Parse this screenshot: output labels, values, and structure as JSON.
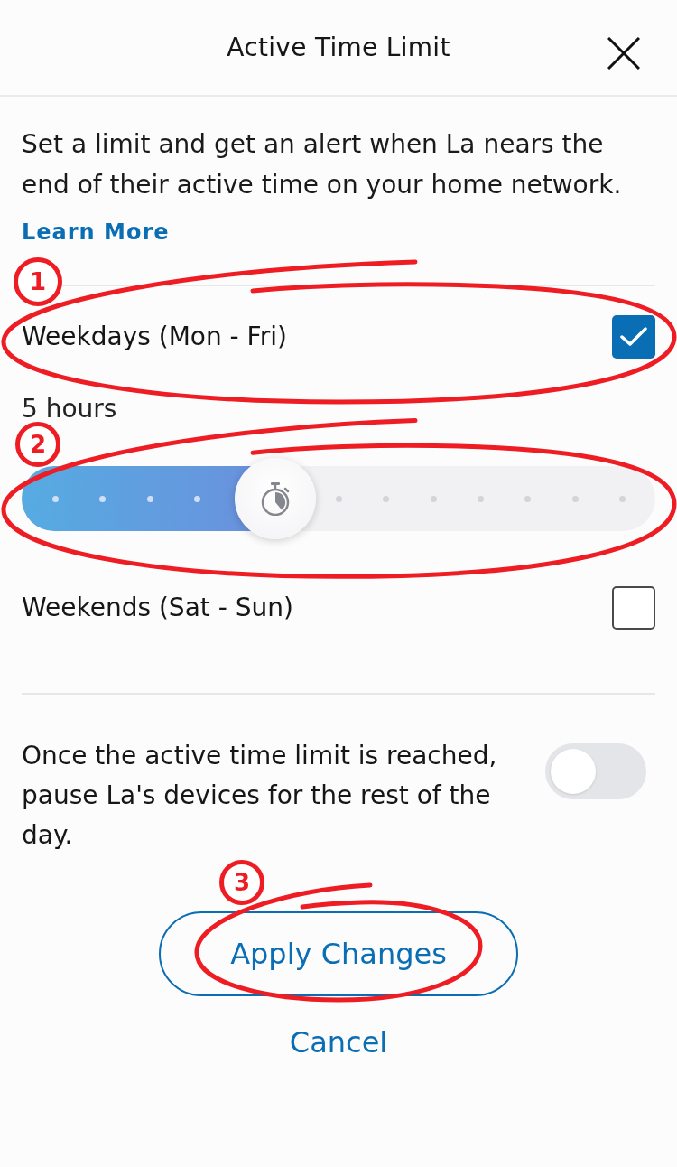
{
  "header": {
    "title": "Active Time Limit"
  },
  "intro": {
    "description": "Set a limit and get an alert when La nears the end of their active time on your home network.",
    "link": "Learn More"
  },
  "schedules": [
    {
      "label": "Weekdays (Mon - Fri)",
      "checked": true,
      "annotation": "1",
      "duration": {
        "reading": "5 hours",
        "level": 0.4,
        "annotation": "2"
      }
    },
    {
      "label": "Weekends (Sat - Sun)",
      "checked": false
    }
  ],
  "pause_setting": {
    "text": "Once the active time limit is reached, pause La's devices for the rest of the day.",
    "on": false
  },
  "buttons": [
    {
      "label": "Apply Changes",
      "kind": "confirm",
      "annotation": "3"
    },
    {
      "label": "Cancel",
      "kind": "cancel"
    }
  ]
}
